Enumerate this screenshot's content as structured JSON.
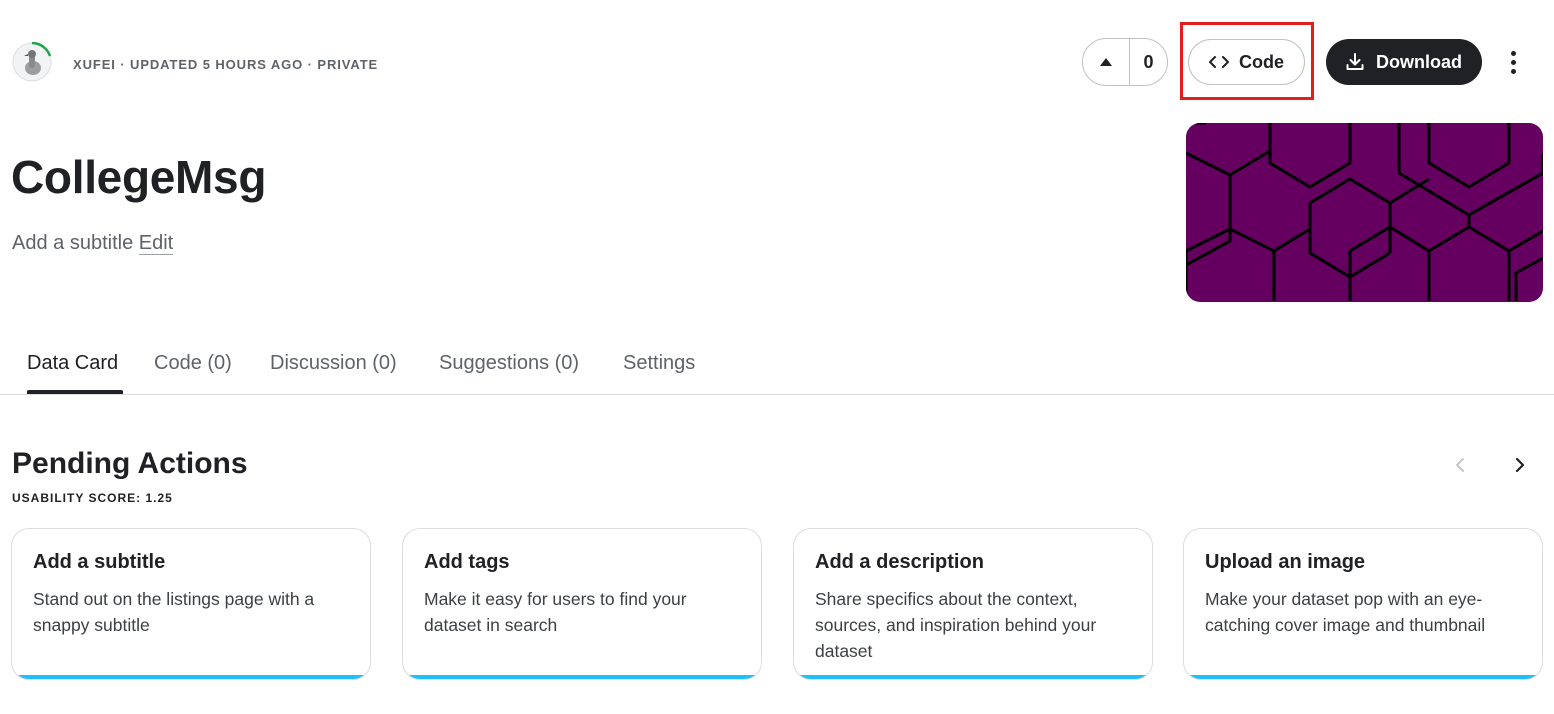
{
  "header": {
    "meta": "XUFEI · UPDATED 5 HOURS AGO · PRIVATE",
    "vote_count": "0",
    "code_label": "Code",
    "download_label": "Download"
  },
  "dataset": {
    "title": "CollegeMsg",
    "subtitle_placeholder": "Add a subtitle",
    "edit_label": "Edit"
  },
  "tabs": [
    {
      "label": "Data Card",
      "active": true
    },
    {
      "label": "Code (0)"
    },
    {
      "label": "Discussion (0)"
    },
    {
      "label": "Suggestions (0)"
    },
    {
      "label": "Settings"
    }
  ],
  "pending_actions": {
    "title": "Pending Actions",
    "usability": "USABILITY SCORE: 1.25",
    "cards": [
      {
        "title": "Add a subtitle",
        "description": "Stand out on the listings page with a snappy subtitle"
      },
      {
        "title": "Add tags",
        "description": "Make it easy for users to find your dataset in search"
      },
      {
        "title": "Add a description",
        "description": "Share specifics about the context, sources, and inspiration behind your dataset"
      },
      {
        "title": "Upload an image",
        "description": "Make your dataset pop with an eye-catching cover image and thumbnail"
      }
    ]
  },
  "colors": {
    "accent_bar": "#20beff",
    "cover_background": "#650060",
    "highlight": "#e0201c",
    "primary_button": "#202124"
  },
  "icons": {
    "avatar": "goose-avatar",
    "upvote": "triangle-up-icon",
    "code": "code-brackets-icon",
    "download": "download-icon",
    "more": "more-vertical-icon",
    "prev": "chevron-left-icon",
    "next": "chevron-right-icon"
  }
}
